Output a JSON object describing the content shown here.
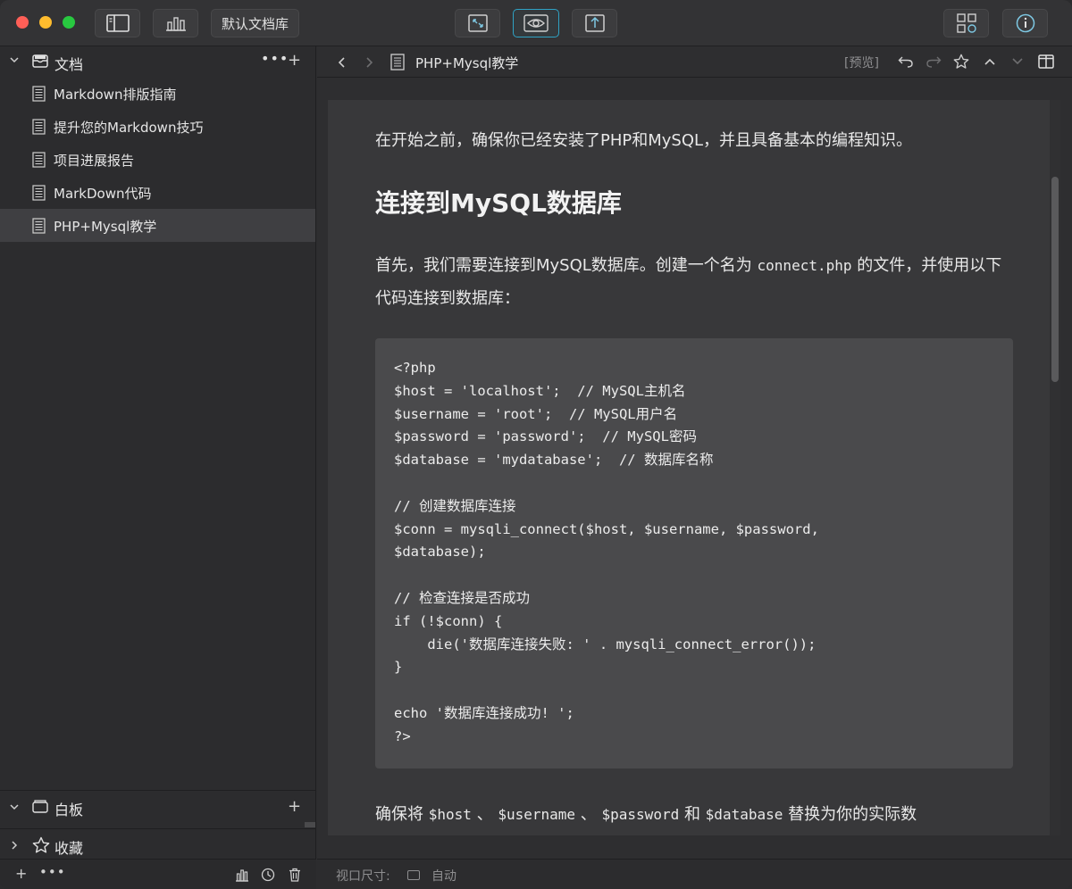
{
  "titlebar": {
    "library_button_label": "默认文档库",
    "left_buttons": [
      "sidebar-toggle-icon",
      "stats-icon"
    ],
    "center_buttons": [
      "expand-icon",
      "eye-icon",
      "share-icon"
    ],
    "right_buttons": [
      "grid-icon",
      "info-icon"
    ]
  },
  "sidebar": {
    "section_title": "文档",
    "more_label": "•••",
    "add_label": "+",
    "documents": [
      {
        "label": "Markdown排版指南",
        "selected": false
      },
      {
        "label": "提升您的Markdown技巧",
        "selected": false
      },
      {
        "label": "项目进展报告",
        "selected": false
      },
      {
        "label": "MarkDown代码",
        "selected": false
      },
      {
        "label": "PHP+Mysql教学",
        "selected": true
      }
    ],
    "whiteboard": {
      "label": "白板",
      "add_label": "+"
    },
    "favorites": {
      "label": "收藏"
    },
    "footer": {
      "add_label": "+",
      "more_label": "•••"
    }
  },
  "navbar": {
    "doc_title": "PHP+Mysql教学",
    "preview_label": "[预览]"
  },
  "content": {
    "intro": "在开始之前，确保你已经安装了PHP和MySQL，并且具备基本的编程知识。",
    "heading": "连接到MySQL数据库",
    "para_before": "首先，我们需要连接到MySQL数据库。创建一个名为 ",
    "para_code": "connect.php",
    "para_after": " 的文件，并使用以下代码连接到数据库：",
    "code": "<?php\n$host = 'localhost';  // MySQL主机名\n$username = 'root';  // MySQL用户名\n$password = 'password';  // MySQL密码\n$database = 'mydatabase';  // 数据库名称\n\n// 创建数据库连接\n$conn = mysqli_connect($host, $username, $password,\n$database);\n\n// 检查连接是否成功\nif (!$conn) {\n    die('数据库连接失败: ' . mysqli_connect_error());\n}\n\necho '数据库连接成功! ';\n?>",
    "footer_start": "确保将 ",
    "footer_code1": "$host",
    "footer_sep1": " 、 ",
    "footer_code2": "$username",
    "footer_sep2": " 、 ",
    "footer_code3": "$password",
    "footer_and": " 和 ",
    "footer_code4": "$database",
    "footer_end": " 替换为你的实际数"
  },
  "statusbar": {
    "viewport_label": "视口尺寸:",
    "viewport_value": "自动"
  }
}
